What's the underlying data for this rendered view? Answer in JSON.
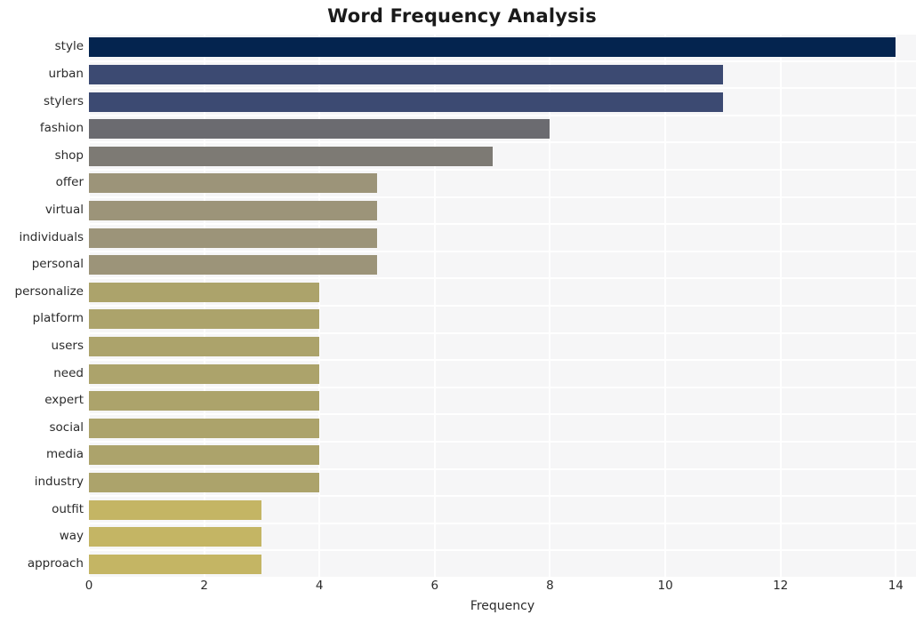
{
  "chart_data": {
    "type": "bar",
    "orientation": "horizontal",
    "title": "Word Frequency Analysis",
    "xlabel": "Frequency",
    "ylabel": "",
    "categories": [
      "style",
      "urban",
      "stylers",
      "fashion",
      "shop",
      "offer",
      "virtual",
      "individuals",
      "personal",
      "personalize",
      "platform",
      "users",
      "need",
      "expert",
      "social",
      "media",
      "industry",
      "outfit",
      "way",
      "approach"
    ],
    "values": [
      14,
      11,
      11,
      8,
      7,
      5,
      5,
      5,
      5,
      4,
      4,
      4,
      4,
      4,
      4,
      4,
      4,
      3,
      3,
      3
    ],
    "bar_colors": [
      "#04244f",
      "#3c4a72",
      "#3c4a72",
      "#6b6b70",
      "#7d7a74",
      "#9c9479",
      "#9c9479",
      "#9c9479",
      "#9c9479",
      "#ac a36b",
      "#aca36b",
      "#aca36b",
      "#aca36b",
      "#aca36b",
      "#aca36b",
      "#aca36b",
      "#aca36b",
      "#c4b564",
      "#c4b564",
      "#c4b564"
    ],
    "xlim": [
      0,
      14.35
    ],
    "xticks": [
      0,
      2,
      4,
      6,
      8,
      10,
      12,
      14
    ],
    "xticklabels": [
      "0",
      "2",
      "4",
      "6",
      "8",
      "10",
      "12",
      "14"
    ],
    "grid": true,
    "legend": null,
    "plot_background": "#f6f6f7",
    "gridline_color": "#ffffff",
    "figure_background": "#ffffff"
  }
}
